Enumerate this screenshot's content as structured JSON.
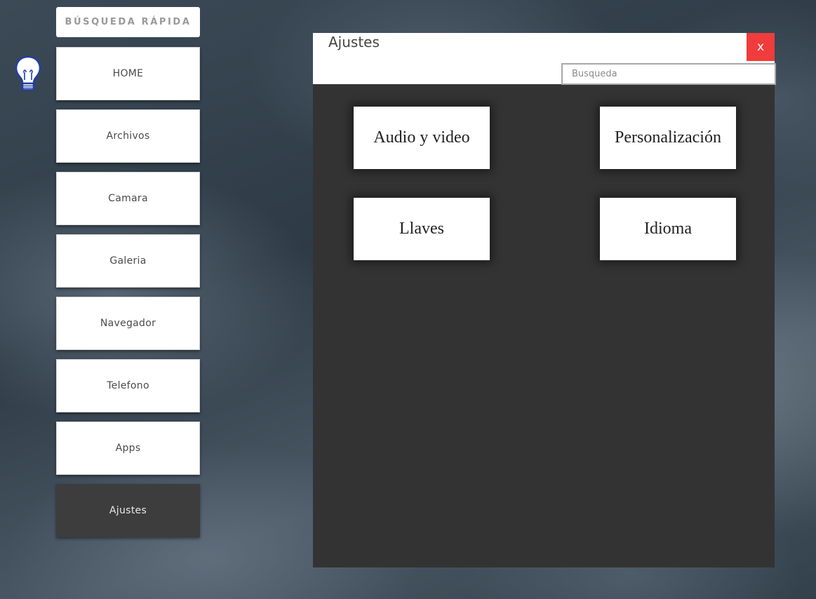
{
  "quick_search": {
    "label": "BÚSQUEDA RÁPIDA"
  },
  "sidebar": {
    "items": [
      {
        "label": "HOME"
      },
      {
        "label": "Archivos"
      },
      {
        "label": "Camara"
      },
      {
        "label": "Galeria"
      },
      {
        "label": "Navegador"
      },
      {
        "label": "Telefono"
      },
      {
        "label": "Apps"
      },
      {
        "label": "Ajustes",
        "active": true
      }
    ]
  },
  "settings_panel": {
    "title": "Ajustes",
    "close_label": "x",
    "search_placeholder": "Busqueda",
    "tiles": [
      {
        "label": "Audio y video"
      },
      {
        "label": "Personalización"
      },
      {
        "label": "Llaves"
      },
      {
        "label": "Idioma"
      }
    ]
  },
  "colors": {
    "close_button": "#f03c3c",
    "panel_background": "#333333",
    "active_nav": "#3d3d3d",
    "bulb_outline": "#1f3fa8"
  },
  "icons": {
    "bulb": "lightbulb-icon"
  }
}
